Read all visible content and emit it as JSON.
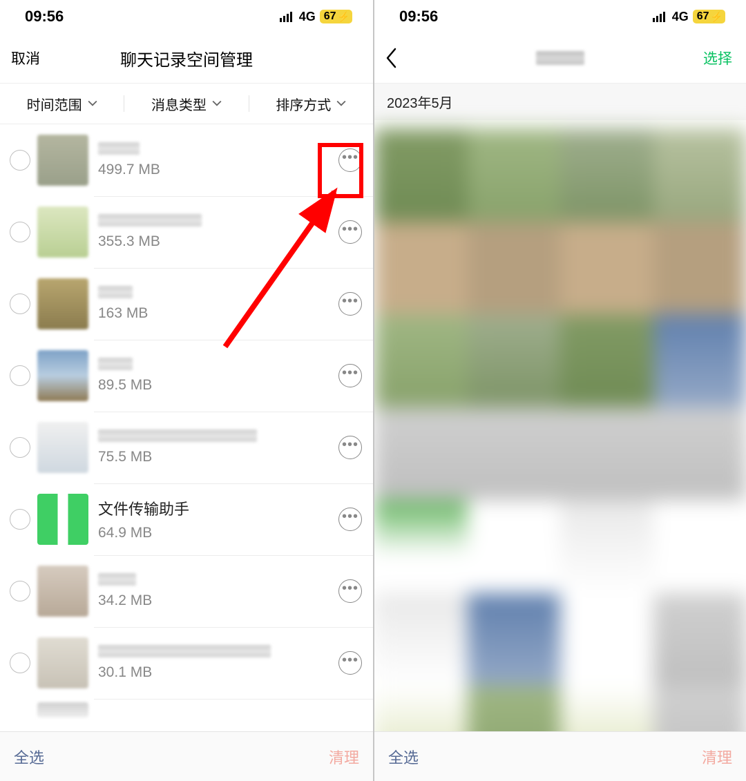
{
  "status": {
    "time": "09:56",
    "network": "4G",
    "battery": "67"
  },
  "left": {
    "cancel": "取消",
    "title": "聊天记录空间管理",
    "filters": {
      "time_range": "时间范围",
      "msg_type": "消息类型",
      "sort": "排序方式"
    },
    "rows": [
      {
        "name": "",
        "size": "499.7 MB"
      },
      {
        "name": "",
        "size": "355.3 MB"
      },
      {
        "name": "",
        "size": "163 MB"
      },
      {
        "name": "",
        "size": "89.5 MB"
      },
      {
        "name": "",
        "size": "75.5 MB"
      },
      {
        "name": "文件传输助手",
        "size": "64.9 MB"
      },
      {
        "name": "",
        "size": "34.2 MB"
      },
      {
        "name": "",
        "size": "30.1 MB"
      }
    ],
    "select_all": "全选",
    "cleanup": "清理"
  },
  "right": {
    "section_date": "2023年5月",
    "select": "选择",
    "select_all": "全选",
    "cleanup": "清理"
  }
}
